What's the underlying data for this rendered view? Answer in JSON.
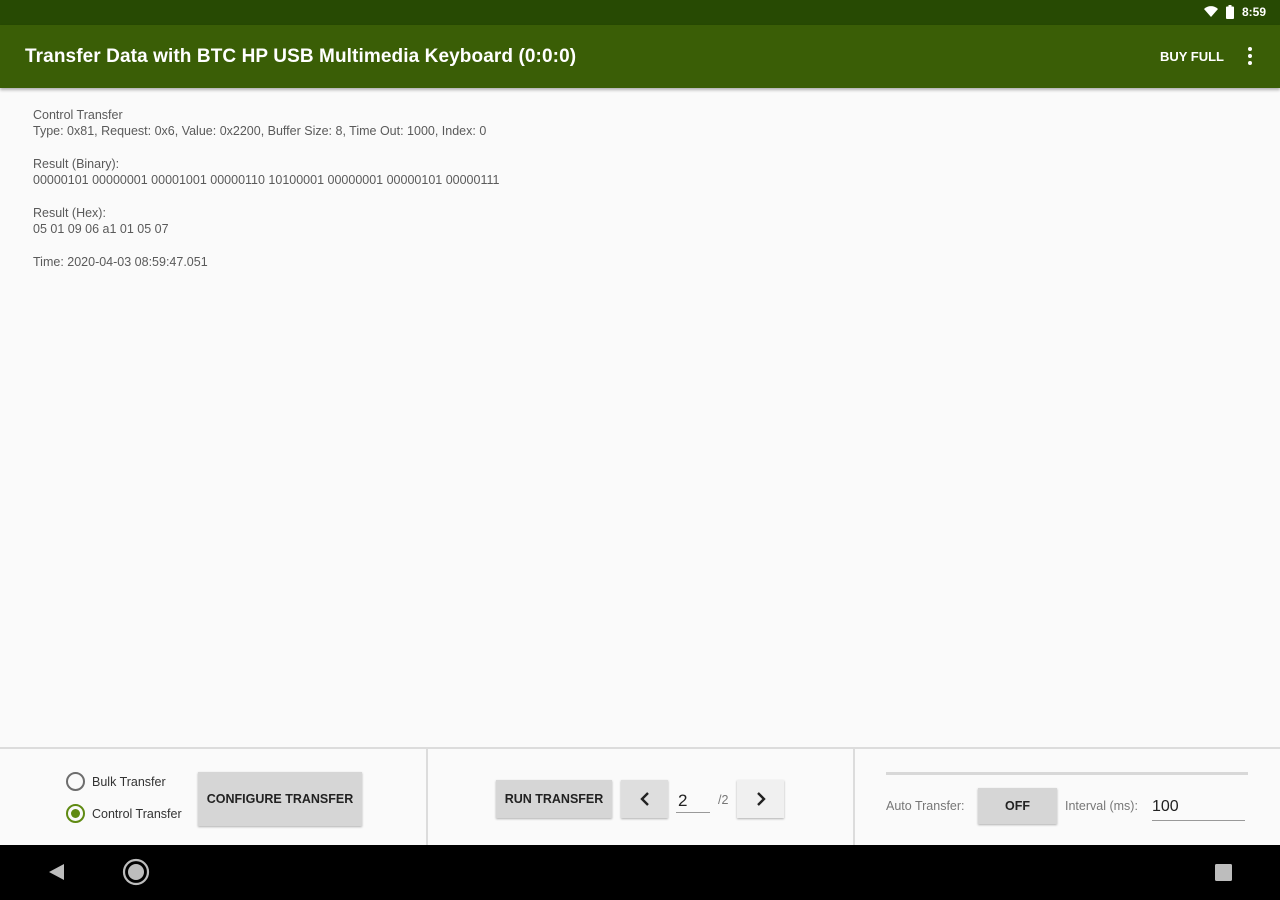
{
  "status_bar": {
    "time": "8:59"
  },
  "app_bar": {
    "title": "Transfer Data with BTC HP USB Multimedia Keyboard (0:0:0)",
    "buy_full": "BUY FULL"
  },
  "content": {
    "transfer_type": "Control Transfer",
    "params": "Type: 0x81, Request: 0x6, Value: 0x2200, Buffer Size: 8, Time Out: 1000, Index: 0",
    "binary_label": "Result (Binary):",
    "binary_value": "00000101 00000001 00001001 00000110 10100001 00000001 00000101 00000111",
    "hex_label": "Result (Hex):",
    "hex_value": "05 01 09 06 a1 01 05 07",
    "time": "Time: 2020-04-03 08:59:47.051"
  },
  "bottom": {
    "bulk_label": "Bulk Transfer",
    "control_label": "Control Transfer",
    "selected": "control",
    "configure_label": "CONFIGURE TRANSFER",
    "run_label": "RUN TRANSFER",
    "page_value": "2",
    "page_total": "/2",
    "auto_label": "Auto Transfer:",
    "auto_state": "OFF",
    "interval_label": "Interval (ms):",
    "interval_value": "100"
  },
  "colors": {
    "status_bar": "#274a03",
    "app_bar": "#3a5e06",
    "accent": "#5f8a12"
  }
}
